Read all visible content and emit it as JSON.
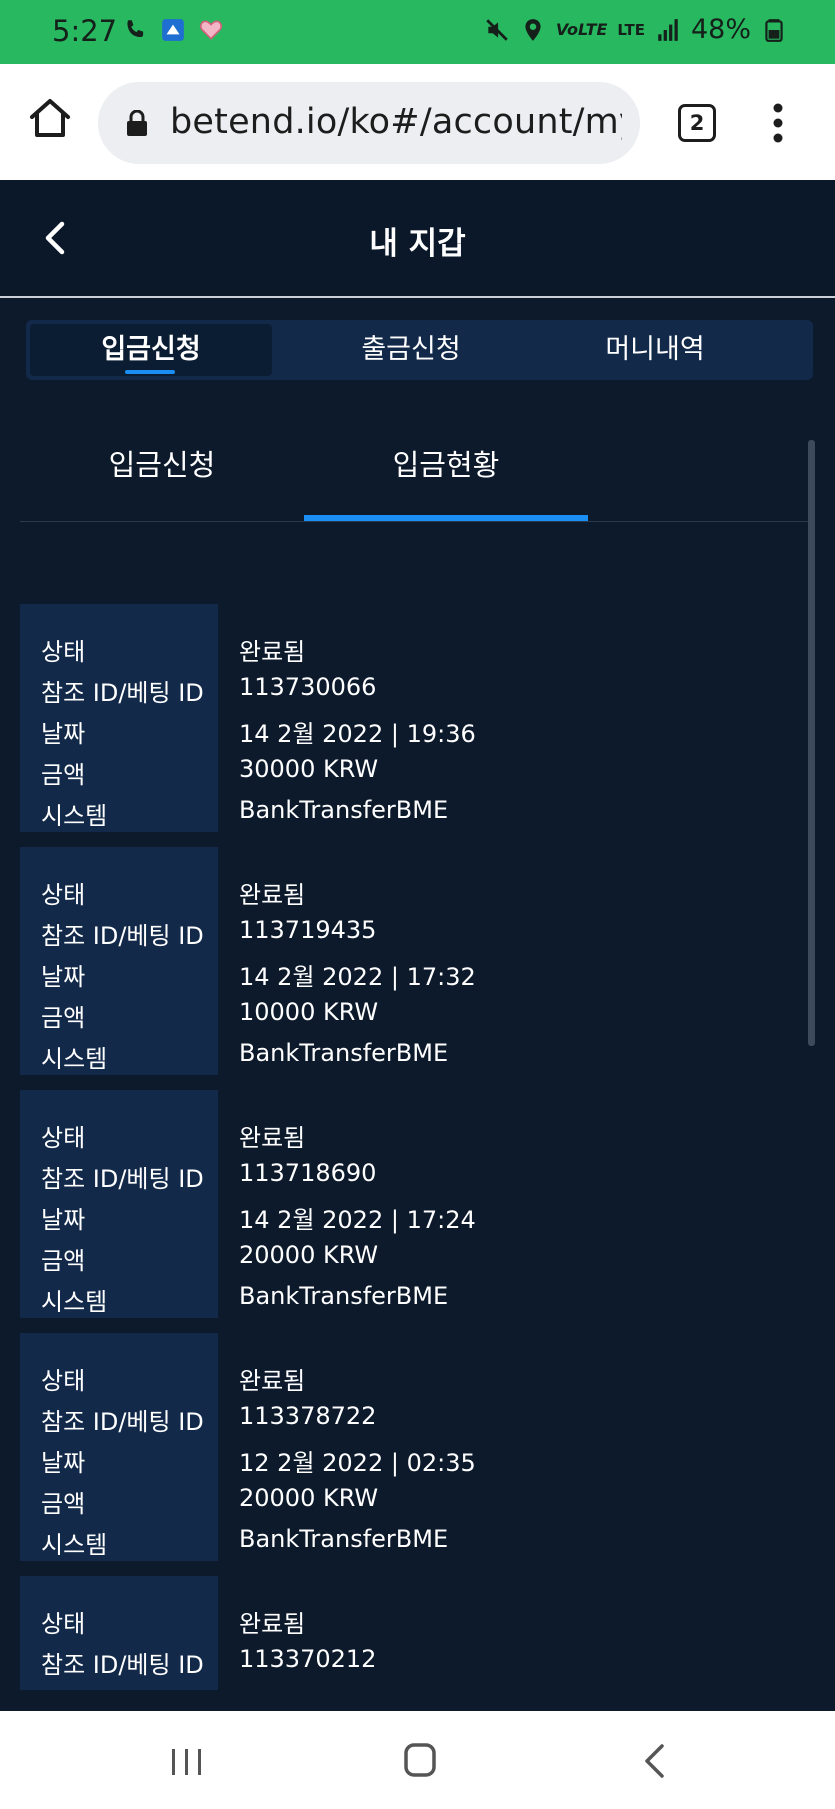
{
  "status_bar": {
    "time": "5:27",
    "battery": "48%",
    "network": "LTE",
    "icons": [
      "phone-icon",
      "app-notification-icon",
      "heart-icon",
      "mute-icon",
      "location-icon",
      "volte-icon",
      "signal-icon",
      "battery-icon"
    ]
  },
  "browser": {
    "url": "betend.io/ko#/account/my-w",
    "tab_count": "2"
  },
  "header": {
    "title": "내 지갑"
  },
  "main_tabs": [
    {
      "label": "입금신청",
      "active": true
    },
    {
      "label": "출금신청",
      "active": false
    },
    {
      "label": "머니내역",
      "active": false
    }
  ],
  "sub_tabs": [
    {
      "label": "입금신청",
      "active": false
    },
    {
      "label": "입금현황",
      "active": true
    }
  ],
  "labels": {
    "status": "상태",
    "ref_id": "참조 ID/베팅 ID",
    "date": "날짜",
    "amount": "금액",
    "system": "시스템"
  },
  "records": [
    {
      "status": "완료됨",
      "ref_id": "113730066",
      "date": "14 2월 2022 | 19:36",
      "amount": "30000 KRW",
      "system": "BankTransferBME"
    },
    {
      "status": "완료됨",
      "ref_id": "113719435",
      "date": "14 2월 2022 | 17:32",
      "amount": "10000 KRW",
      "system": "BankTransferBME"
    },
    {
      "status": "완료됨",
      "ref_id": "113718690",
      "date": "14 2월 2022 | 17:24",
      "amount": "20000 KRW",
      "system": "BankTransferBME"
    },
    {
      "status": "완료됨",
      "ref_id": "113378722",
      "date": "12 2월 2022 | 02:35",
      "amount": "20000 KRW",
      "system": "BankTransferBME"
    },
    {
      "status": "완료됨",
      "ref_id": "113370212",
      "date": "",
      "amount": "",
      "system": ""
    }
  ],
  "colors": {
    "status_bar": "#27b860",
    "page_bg": "#0c1a2c",
    "panel_bg": "#12294a",
    "accent": "#1a8ef2"
  }
}
